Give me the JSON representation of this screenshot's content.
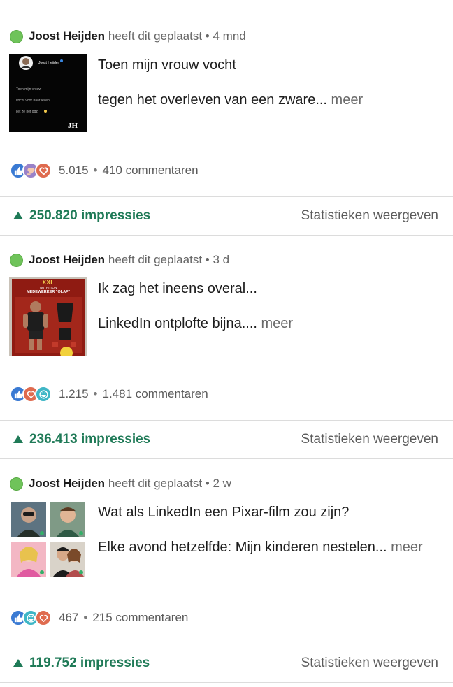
{
  "colors": {
    "accent_green": "#1f7a57",
    "status_dot": "#6fc35a",
    "like": "#3a7ad3",
    "love": "#df6b4f",
    "support": "#9a82c9",
    "funny": "#3fb6c6"
  },
  "posts": [
    {
      "author": "Joost Heijden",
      "meta": "heeft dit geplaatst • 4 mnd",
      "thumb": {
        "type": "text-card",
        "header_name": "Joost Heijden",
        "lines": [
          "Toen mijn vrouw",
          "vocht voor haar leven",
          "liet ze het ggz"
        ],
        "initials": "JH"
      },
      "line1": "Toen mijn vrouw vocht",
      "line2": "tegen het overleven van een zware...",
      "more": " meer",
      "reaction_icons": [
        "like-icon",
        "support-icon",
        "love-icon"
      ],
      "reaction_count": "5.015",
      "comments": "410 commentaren",
      "impressions": "250.820 impressies",
      "stats_label": "Statistieken weergeven"
    },
    {
      "author": "Joost Heijden",
      "meta": "heeft dit geplaatst • 3 d",
      "thumb": {
        "type": "action-figure",
        "brand": "XXL",
        "sub": "NUTRITION",
        "caption": "MEDEWERKER \"OLAF\""
      },
      "line1": "Ik zag het ineens overal...",
      "line2": "LinkedIn ontplofte bijna....",
      "more": " meer",
      "reaction_icons": [
        "like-icon",
        "love-icon",
        "funny-icon"
      ],
      "reaction_count": "1.215",
      "comments": "1.481 commentaren",
      "impressions": "236.413 impressies",
      "stats_label": "Statistieken weergeven"
    },
    {
      "author": "Joost Heijden",
      "meta": "heeft dit geplaatst • 2 w",
      "thumb": {
        "type": "pixar-grid"
      },
      "line1": "Wat als LinkedIn een Pixar-film zou zijn?",
      "line2": "Elke avond hetzelfde: Mijn kinderen nestelen...",
      "more": " meer",
      "reaction_icons": [
        "like-icon",
        "funny-icon",
        "love-icon"
      ],
      "reaction_count": "467",
      "comments": "215 commentaren",
      "impressions": "119.752 impressies",
      "stats_label": "Statistieken weergeven"
    }
  ]
}
